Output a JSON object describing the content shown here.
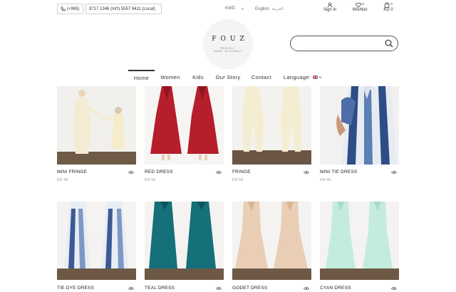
{
  "topbar": {
    "country_code": "(+965)",
    "phone_numbers": "9717 1346 (Int'l) 5557 9411 (Local)",
    "currency": "KWD",
    "language_en": "English",
    "language_ar": "العربية",
    "signin_label": "Sign in",
    "wishlist_label": "Wishlist",
    "wishlist_count": "0",
    "cart_count": "0",
    "cart_total": "KD 0"
  },
  "logo": {
    "name": "FOUZ",
    "tagline_1": "PROUDLY",
    "tagline_2": "MADE IN KUWAIT"
  },
  "search": {
    "placeholder": "",
    "value": ""
  },
  "nav": {
    "home": "Home",
    "women": "Women",
    "kids": "Kids",
    "story": "Our Story",
    "contact": "Contact",
    "language": "Language:"
  },
  "products": [
    {
      "name": "MINI FRINGE",
      "price": "KD 45"
    },
    {
      "name": "RED DRESS",
      "price": "KD 55"
    },
    {
      "name": "FRINGE",
      "price": "KD 55"
    },
    {
      "name": "MINI TIE DRESS",
      "price": "KD 45"
    },
    {
      "name": "TIE DYE DRESS",
      "price": ""
    },
    {
      "name": "TEAL DRESS",
      "price": ""
    },
    {
      "name": "GODET DRESS",
      "price": ""
    },
    {
      "name": "CYAN DRESS",
      "price": ""
    }
  ],
  "colors": {
    "text": "#333333",
    "muted": "#999999",
    "border": "#cfcfcf"
  },
  "icons": {
    "phone": "phone-icon",
    "user": "user-icon",
    "heart": "heart-icon",
    "bag": "shopping-bag-icon",
    "search": "search-icon",
    "eye": "eye-icon",
    "flag": "uk-flag-icon"
  }
}
